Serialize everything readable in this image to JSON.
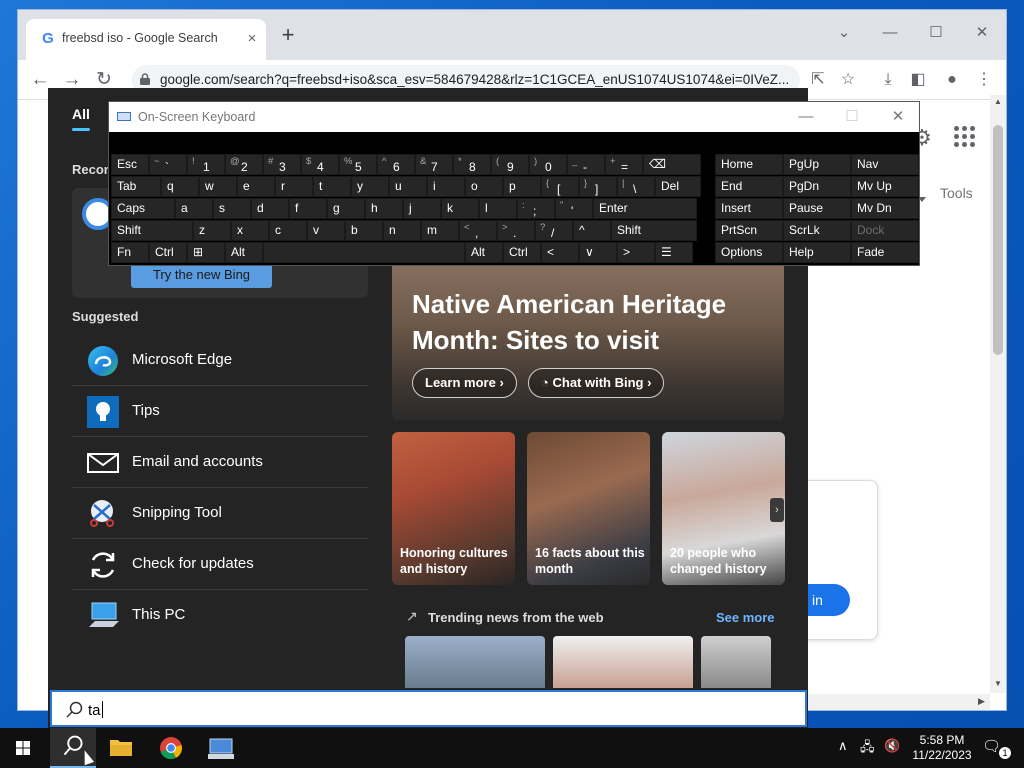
{
  "browser": {
    "tab_title": "freebsd iso - Google Search",
    "url": "google.com/search?q=freebsd+iso&sca_esv=584679428&rlz=1C1GCEA_enUS1074US1074&ei=0IVeZ...",
    "tools_label": "Tools",
    "sign_in_partial": "in",
    "new_tab_icon": "+",
    "close_tab_icon": "×"
  },
  "start_menu": {
    "tab_all": "All",
    "recommended_label": "Recom",
    "try_bing": "Try the new Bing",
    "suggested_label": "Suggested",
    "suggested": [
      {
        "label": "Microsoft Edge",
        "icon": "edge-icon"
      },
      {
        "label": "Tips",
        "icon": "tips-icon"
      },
      {
        "label": "Email and accounts",
        "icon": "mail-icon"
      },
      {
        "label": "Snipping Tool",
        "icon": "snipping-tool-icon"
      },
      {
        "label": "Check for updates",
        "icon": "refresh-icon"
      },
      {
        "label": "This PC",
        "icon": "this-pc-icon"
      }
    ],
    "hero": {
      "title": "Native American Heritage Month: Sites to visit",
      "learn_more": "Learn more",
      "chat_with_bing": "Chat with Bing"
    },
    "news": [
      {
        "caption": "Honoring cultures and history"
      },
      {
        "caption": "16 facts about this month"
      },
      {
        "caption": "20 people who changed history"
      }
    ],
    "trending_label": "Trending news from the web",
    "see_more": "See more",
    "search_text": "ta"
  },
  "osk": {
    "title": "On-Screen Keyboard",
    "rows": [
      [
        {
          "m": "Esc"
        },
        {
          "s": "~",
          "m": "`"
        },
        {
          "s": "!",
          "m": "1"
        },
        {
          "s": "@",
          "m": "2"
        },
        {
          "s": "#",
          "m": "3"
        },
        {
          "s": "$",
          "m": "4"
        },
        {
          "s": "%",
          "m": "5"
        },
        {
          "s": "^",
          "m": "6"
        },
        {
          "s": "&",
          "m": "7"
        },
        {
          "s": "*",
          "m": "8"
        },
        {
          "s": "(",
          "m": "9"
        },
        {
          "s": ")",
          "m": "0"
        },
        {
          "s": "_",
          "m": "-"
        },
        {
          "s": "+",
          "m": "="
        },
        {
          "m": "⌫"
        }
      ],
      [
        {
          "m": "Tab"
        },
        {
          "m": "q"
        },
        {
          "m": "w"
        },
        {
          "m": "e"
        },
        {
          "m": "r"
        },
        {
          "m": "t"
        },
        {
          "m": "y"
        },
        {
          "m": "u"
        },
        {
          "m": "i"
        },
        {
          "m": "o"
        },
        {
          "m": "p"
        },
        {
          "s": "{",
          "m": "["
        },
        {
          "s": "}",
          "m": "]"
        },
        {
          "s": "|",
          "m": "\\"
        },
        {
          "m": "Del"
        }
      ],
      [
        {
          "m": "Caps"
        },
        {
          "m": "a"
        },
        {
          "m": "s"
        },
        {
          "m": "d"
        },
        {
          "m": "f"
        },
        {
          "m": "g"
        },
        {
          "m": "h"
        },
        {
          "m": "j"
        },
        {
          "m": "k"
        },
        {
          "m": "l"
        },
        {
          "s": ":",
          "m": ";"
        },
        {
          "s": "\"",
          "m": "'"
        },
        {
          "m": "Enter"
        }
      ],
      [
        {
          "m": "Shift"
        },
        {
          "m": "z"
        },
        {
          "m": "x"
        },
        {
          "m": "c"
        },
        {
          "m": "v"
        },
        {
          "m": "b"
        },
        {
          "m": "n"
        },
        {
          "m": "m"
        },
        {
          "s": "<",
          "m": ","
        },
        {
          "s": ">",
          "m": "."
        },
        {
          "s": "?",
          "m": "/"
        },
        {
          "m": "^"
        },
        {
          "m": "Shift"
        }
      ],
      [
        {
          "m": "Fn"
        },
        {
          "m": "Ctrl"
        },
        {
          "m": "⊞"
        },
        {
          "m": "Alt"
        },
        {
          "m": ""
        },
        {
          "m": "Alt"
        },
        {
          "m": "Ctrl"
        },
        {
          "m": "<"
        },
        {
          "m": "∨"
        },
        {
          "m": ">"
        },
        {
          "m": "☰"
        }
      ]
    ],
    "nav_rows": [
      [
        "Home",
        "PgUp",
        "Nav"
      ],
      [
        "End",
        "PgDn",
        "Mv Up"
      ],
      [
        "Insert",
        "Pause",
        "Mv Dn"
      ],
      [
        "PrtScn",
        "ScrLk",
        "Dock"
      ],
      [
        "Options",
        "Help",
        "Fade"
      ]
    ]
  },
  "taskbar": {
    "time": "5:58 PM",
    "date": "11/22/2023",
    "notifications_count": "1"
  },
  "colors": {
    "accent": "#4cc2ff",
    "start_bg": "#242424",
    "taskbar_bg": "#101010",
    "google_blue": "#1a73e8"
  }
}
